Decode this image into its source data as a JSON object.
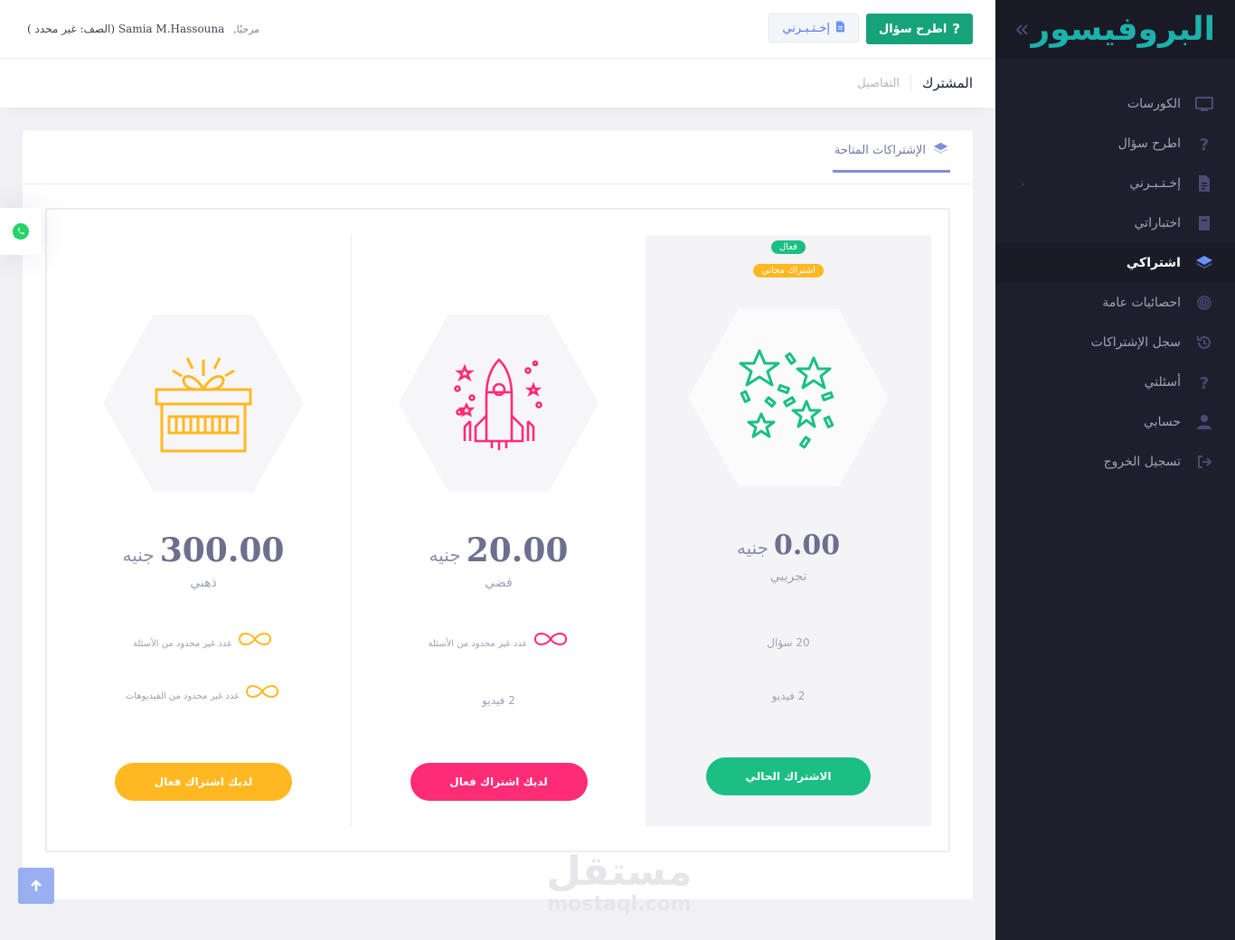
{
  "header": {
    "greeting_prefix": "مرحبًا,",
    "user_name": "Samia M.Hassouna",
    "grade": "(الصف: غير محدد )",
    "ask_button": "اطرح سؤال",
    "test_button": "إخـتـبـرني"
  },
  "subheader": {
    "title": "المشترك",
    "crumb": "التفاصيل"
  },
  "sidebar": {
    "brand": "البروفيسور",
    "items": [
      {
        "label": "الكورسات",
        "icon": "monitor-icon"
      },
      {
        "label": "اطرح سؤال",
        "icon": "question-icon"
      },
      {
        "label": "إخـتـبـرني",
        "icon": "document-icon"
      },
      {
        "label": "اختباراتي",
        "icon": "book-icon"
      },
      {
        "label": "اشتراكي",
        "icon": "layers-icon"
      },
      {
        "label": "احصائيات عامة",
        "icon": "fingerprint-icon"
      },
      {
        "label": "سجل الإشتراكات",
        "icon": "history-icon"
      },
      {
        "label": "أسئلتي",
        "icon": "question-icon"
      },
      {
        "label": "حسابي",
        "icon": "user-icon"
      },
      {
        "label": "تسجيل الخروج",
        "icon": "logout-icon"
      }
    ]
  },
  "card": {
    "tab_label": "الإشتراكات المتاحة"
  },
  "plans": {
    "gold": {
      "price": "300.00",
      "currency": "جنيه",
      "name": "ذهبي",
      "feature1": "عدد غير محدود من الأسئلة",
      "feature2": "عدد غير محدود من الفيديوهات",
      "button": "لديك اشتراك فعال",
      "color": "#ffb822"
    },
    "silver": {
      "price": "20.00",
      "currency": "جنيه",
      "name": "فضي",
      "feature1": "عدد غير محدود من الأسئلة",
      "feature2": "2 فيديو",
      "button": "لديك اشتراك فعال",
      "color": "#fd2c75"
    },
    "trial": {
      "price": "0.00",
      "currency": "جنيه",
      "name": "تجريبي",
      "badge_active": "فعال",
      "badge_free": "اشتراك مجاني",
      "feature1": "20 سؤال",
      "feature2": "2 فيديو",
      "button": "الاشتراك الحالي",
      "color": "#1bbf83"
    }
  },
  "watermark": {
    "arabic": "مستقل",
    "latin": "mostaql.com"
  }
}
